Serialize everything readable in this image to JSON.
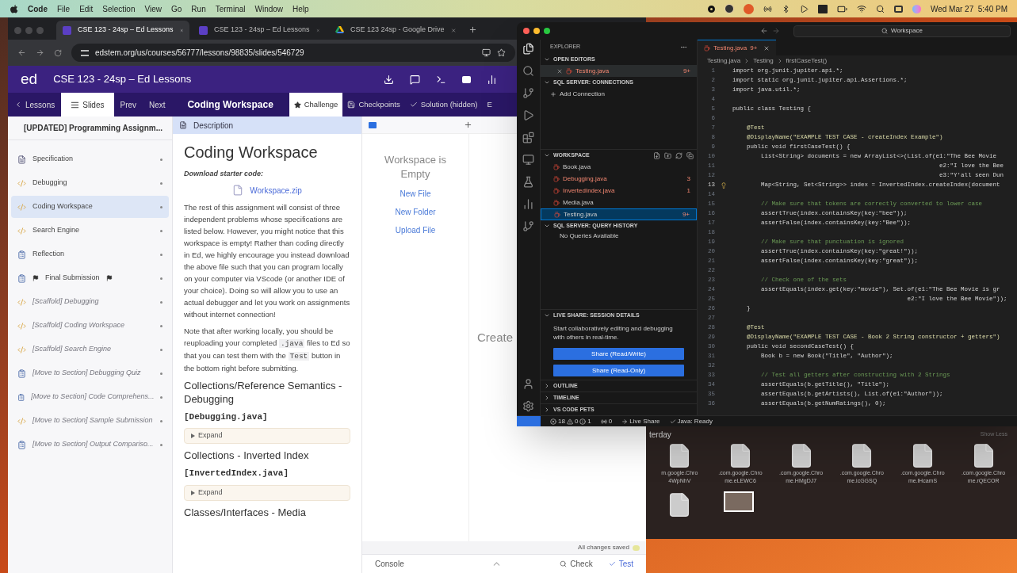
{
  "menubar": {
    "app": "Code",
    "menus": [
      "File",
      "Edit",
      "Selection",
      "View",
      "Go",
      "Run",
      "Terminal",
      "Window",
      "Help"
    ],
    "clock": "Wed Mar 27  5:40 PM"
  },
  "browser": {
    "tabs": [
      {
        "label": "CSE 123 - 24sp – Ed Lessons",
        "selected": true,
        "kind": "ed"
      },
      {
        "label": "CSE 123 - 24sp – Ed Lessons",
        "selected": false,
        "kind": "ed"
      },
      {
        "label": "CSE 123 24sp - Google Drive",
        "selected": false,
        "kind": "drive"
      }
    ],
    "url": "edstem.org/us/courses/56777/lessons/98835/slides/546729"
  },
  "ed_header": {
    "logo": "ed",
    "title": "CSE 123 - 24sp – Ed Lessons"
  },
  "lesson_nav": {
    "back": "Lessons",
    "slides": {
      "label": "Slides",
      "selected": true
    },
    "prev": "Prev",
    "next": "Next",
    "title": "Coding Workspace",
    "tabs": [
      {
        "label": "Challenge",
        "selected": true,
        "kind": "star"
      },
      {
        "label": "Checkpoints",
        "selected": false,
        "kind": "save"
      },
      {
        "label": "Solution (hidden)",
        "selected": false,
        "kind": "check"
      },
      {
        "label": "E",
        "selected": false,
        "kind": "plain"
      }
    ]
  },
  "sidebar": {
    "title": "[UPDATED] Programming Assignm...",
    "items": [
      {
        "label": "Specification",
        "kind": "doc",
        "selected": false,
        "struck": false,
        "flags": false
      },
      {
        "label": "Debugging",
        "kind": "code",
        "selected": false,
        "struck": false,
        "flags": false
      },
      {
        "label": "Coding Workspace",
        "kind": "code",
        "selected": true,
        "struck": false,
        "flags": false
      },
      {
        "label": "Search Engine",
        "kind": "code",
        "selected": false,
        "struck": false,
        "flags": false
      },
      {
        "label": "Reflection",
        "kind": "quiz",
        "selected": false,
        "struck": false,
        "flags": false
      },
      {
        "label": "Final Submission",
        "kind": "quiz",
        "selected": false,
        "struck": false,
        "flags": true
      },
      {
        "label": "[Scaffold] Debugging",
        "kind": "code",
        "selected": false,
        "struck": true,
        "flags": false
      },
      {
        "label": "[Scaffold] Coding Workspace",
        "kind": "code",
        "selected": false,
        "struck": true,
        "flags": false
      },
      {
        "label": "[Scaffold] Search Engine",
        "kind": "code",
        "selected": false,
        "struck": true,
        "flags": false
      },
      {
        "label": "[Move to Section] Debugging Quiz",
        "kind": "quiz",
        "selected": false,
        "struck": true,
        "flags": false
      },
      {
        "label": "[Move to Section] Code Comprehens...",
        "kind": "quiz",
        "selected": false,
        "struck": true,
        "flags": false
      },
      {
        "label": "[Move to Section] Sample Submission",
        "kind": "code",
        "selected": false,
        "struck": true,
        "flags": false
      },
      {
        "label": "[Move to Section] Output Compariso...",
        "kind": "quiz",
        "selected": false,
        "struck": true,
        "flags": false
      }
    ]
  },
  "description": {
    "header": "Description",
    "title": "Coding Workspace",
    "download_label": "Download starter code:",
    "file": "Workspace.zip",
    "paragraphs": [
      [
        {
          "kind": "text",
          "text": "The rest of this assignment will consist of three independent problems whose specifications are listed below. However, you might notice that this workspace is empty! Rather than coding directly in Ed, we highly encourage you instead download the above file such that you can program locally on your computer via VScode (or another IDE of your choice). Doing so will allow you to use an actual debugger and let you work on assignments without internet connection!"
        }
      ],
      [
        {
          "kind": "text",
          "text": "Note that after working locally, you should be reuploading your completed "
        },
        {
          "kind": "code",
          "text": ".java"
        },
        {
          "kind": "text",
          "text": " files to Ed so that you can test them with the "
        },
        {
          "kind": "code",
          "text": "Test"
        },
        {
          "kind": "text",
          "text": " button in the bottom right before submitting."
        }
      ]
    ],
    "sections": [
      {
        "title": "Collections/Reference Semantics - Debugging",
        "file": "[Debugging.java]",
        "expand": "Expand"
      },
      {
        "title": "Collections - Inverted Index",
        "file": "[InvertedIndex.java]",
        "expand": "Expand"
      },
      {
        "title": "Classes/Interfaces - Media"
      }
    ]
  },
  "workspace": {
    "empty_title": "Workspace is Empty",
    "actions": [
      "New File",
      "New Folder",
      "Upload File"
    ],
    "create": "Create",
    "saved": "All changes saved",
    "console": "Console",
    "check": "Check",
    "test": "Test"
  },
  "vscode": {
    "search": "Workspace",
    "explorer": {
      "title": "EXPLORER",
      "open_editors": {
        "title": "OPEN EDITORS",
        "files": [
          {
            "name": "Testing.java",
            "badge": "9+",
            "error": true,
            "selected": false
          }
        ]
      },
      "connections": {
        "title": "SQL SERVER: CONNECTIONS",
        "action": "Add Connection"
      },
      "workspace": {
        "title": "WORKSPACE",
        "files": [
          {
            "name": "Book.java",
            "error": false,
            "selected": false
          },
          {
            "name": "Debugging.java",
            "badge": "3",
            "error": true,
            "selected": false
          },
          {
            "name": "InvertedIndex.java",
            "badge": "1",
            "error": true,
            "selected": false
          },
          {
            "name": "Media.java",
            "error": false,
            "selected": false
          },
          {
            "name": "Testing.java",
            "badge": "9+",
            "error": true,
            "selected": true
          }
        ]
      },
      "query_history": {
        "title": "SQL SERVER: QUERY HISTORY",
        "empty": "No Queries Available"
      },
      "live_share": {
        "title": "LIVE SHARE: SESSION DETAILS",
        "text": "Start collaboratively editing and debugging with others in real-time.",
        "buttons": [
          "Share (Read/Write)",
          "Share (Read-Only)"
        ]
      },
      "collapsed": [
        "OUTLINE",
        "TIMELINE",
        "VS CODE PETS"
      ]
    },
    "editor": {
      "tab": {
        "name": "Testing.java",
        "badge": "9+"
      },
      "breadcrumb": [
        "Testing.java",
        "Testing",
        "firstCaseTest()"
      ],
      "lines": [
        {
          "n": "1",
          "kind": "code",
          "text": "import org.junit.jupiter.api.*;"
        },
        {
          "n": "2",
          "kind": "code",
          "text": "import static org.junit.jupiter.api.Assertions.*;"
        },
        {
          "n": "3",
          "kind": "code",
          "text": "import java.util.*;"
        },
        {
          "n": "4"
        },
        {
          "n": "5",
          "kind": "code",
          "text": "public class Testing {"
        },
        {
          "n": "6"
        },
        {
          "n": "7",
          "kind": "annotation",
          "text": "    @Test"
        },
        {
          "n": "8",
          "kind": "annotation",
          "text": "    @DisplayName(\"EXAMPLE TEST CASE - createIndex Example\")"
        },
        {
          "n": "9",
          "kind": "code",
          "text": "    public void firstCaseTest() {"
        },
        {
          "n": "10",
          "kind": "code",
          "text": "        List<String> documents = new ArrayList<>(List.of(e1:\"The Bee Movie"
        },
        {
          "n": "11",
          "kind": "code",
          "text": "                                                          e2:\"I love the Bee"
        },
        {
          "n": "12",
          "kind": "code",
          "text": "                                                          e3:\"Y'all seen Dun"
        },
        {
          "n": "13",
          "kind": "code",
          "text": "        Map<String, Set<String>> index = InvertedIndex.createIndex(document",
          "bulb": true
        },
        {
          "n": "14"
        },
        {
          "n": "15",
          "kind": "comment",
          "text": "        // Make sure that tokens are correctly converted to lower case"
        },
        {
          "n": "16",
          "kind": "code",
          "text": "        assertTrue(index.containsKey(key:\"bee\"));"
        },
        {
          "n": "17",
          "kind": "code",
          "text": "        assertFalse(index.containsKey(key:\"Bee\"));"
        },
        {
          "n": "18"
        },
        {
          "n": "19",
          "kind": "comment",
          "text": "        // Make sure that punctuation is ignored"
        },
        {
          "n": "20",
          "kind": "code",
          "text": "        assertTrue(index.containsKey(key:\"great!\"));"
        },
        {
          "n": "21",
          "kind": "code",
          "text": "        assertFalse(index.containsKey(key:\"great\"));"
        },
        {
          "n": "22"
        },
        {
          "n": "23",
          "kind": "comment",
          "text": "        // Check one of the sets"
        },
        {
          "n": "24",
          "kind": "code",
          "text": "        assertEquals(index.get(key:\"movie\"), Set.of(e1:\"The Bee Movie is gr"
        },
        {
          "n": "25",
          "kind": "code",
          "text": "                                                 e2:\"I love the Bee Movie\"));"
        },
        {
          "n": "26",
          "kind": "code",
          "text": "    }"
        },
        {
          "n": "27"
        },
        {
          "n": "28",
          "kind": "annotation",
          "text": "    @Test"
        },
        {
          "n": "29",
          "kind": "annotation",
          "text": "    @DisplayName(\"EXAMPLE TEST CASE - Book 2 String constructor + getters\")"
        },
        {
          "n": "30",
          "kind": "code",
          "text": "    public void secondCaseTest() {"
        },
        {
          "n": "31",
          "kind": "code",
          "text": "        Book b = new Book(\"Title\", \"Author\");"
        },
        {
          "n": "32"
        },
        {
          "n": "33",
          "kind": "comment",
          "text": "        // Test all getters after constructing with 2 Strings"
        },
        {
          "n": "34",
          "kind": "code",
          "text": "        assertEquals(b.getTitle(), \"Title\");"
        },
        {
          "n": "35",
          "kind": "code",
          "text": "        assertEquals(b.getArtists(), List.of(e1:\"Author\"));"
        },
        {
          "n": "36",
          "kind": "code",
          "text": "        assertEquals(b.getNumRatings(), 0);"
        }
      ]
    },
    "status_bar": {
      "errors": "18",
      "warnings": "0",
      "infos": "1",
      "ports": "0",
      "live_share": "Live Share",
      "java": "Java: Ready"
    }
  },
  "desktop": {
    "group": "terday",
    "toggle": "Show Less",
    "files": [
      {
        "kind": "file",
        "name": "m.google.Chro",
        "suffix": "4WpNhV"
      },
      {
        "kind": "file",
        "name": ".com.google.Chro",
        "suffix": "me.eLEWC6"
      },
      {
        "kind": "file",
        "name": ".com.google.Chro",
        "suffix": "me.HMgDJ7"
      },
      {
        "kind": "file",
        "name": ".com.google.Chro",
        "suffix": "me.icGGSQ"
      },
      {
        "kind": "file",
        "name": ".com.google.Chro",
        "suffix": "me.lHcamS"
      },
      {
        "kind": "file",
        "name": ".com.google.Chro",
        "suffix": "me.rQECOR"
      },
      {
        "kind": "file"
      },
      {
        "kind": "photo"
      }
    ]
  }
}
